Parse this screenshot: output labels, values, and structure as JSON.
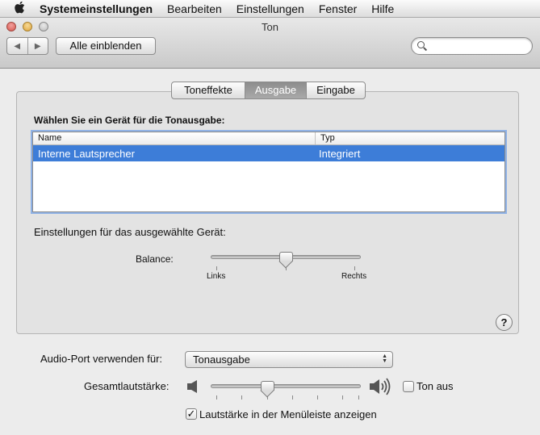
{
  "menubar": {
    "app": "Systemeinstellungen",
    "items": [
      "Bearbeiten",
      "Einstellungen",
      "Fenster",
      "Hilfe"
    ]
  },
  "window": {
    "title": "Ton"
  },
  "toolbar": {
    "show_all_label": "Alle einblenden",
    "search_placeholder": "",
    "back_glyph": "◀",
    "forward_glyph": "▶"
  },
  "tabs": [
    {
      "label": "Toneffekte",
      "selected": false
    },
    {
      "label": "Ausgabe",
      "selected": true
    },
    {
      "label": "Eingabe",
      "selected": false
    }
  ],
  "output": {
    "choose_label": "Wählen Sie ein Gerät für die Tonausgabe:",
    "table": {
      "columns": [
        "Name",
        "Typ"
      ],
      "rows": [
        {
          "name": "Interne Lautsprecher",
          "typ": "Integriert",
          "selected": true
        }
      ]
    },
    "device_settings_label": "Einstellungen für das ausgewählte Gerät:",
    "balance": {
      "label": "Balance:",
      "left_label": "Links",
      "right_label": "Rechts",
      "value": 0.5
    },
    "help_glyph": "?"
  },
  "bottom": {
    "port_label": "Audio-Port verwenden für:",
    "port_value": "Tonausgabe",
    "volume_label": "Gesamtlautstärke:",
    "volume_value": 0.38,
    "mute_label": "Ton aus",
    "mute_checked": false,
    "show_in_menubar_label": "Lautstärke in der Menüleiste anzeigen",
    "show_in_menubar_checked": true,
    "check_glyph": "✓"
  },
  "colors": {
    "selection": "#3d7dd8",
    "focus_ring": "#8fb2e6"
  },
  "icons": {
    "apple": "apple-logo-icon",
    "search": "magnifier-icon",
    "volume_low": "speaker-low-icon",
    "volume_high": "speaker-high-icon"
  }
}
